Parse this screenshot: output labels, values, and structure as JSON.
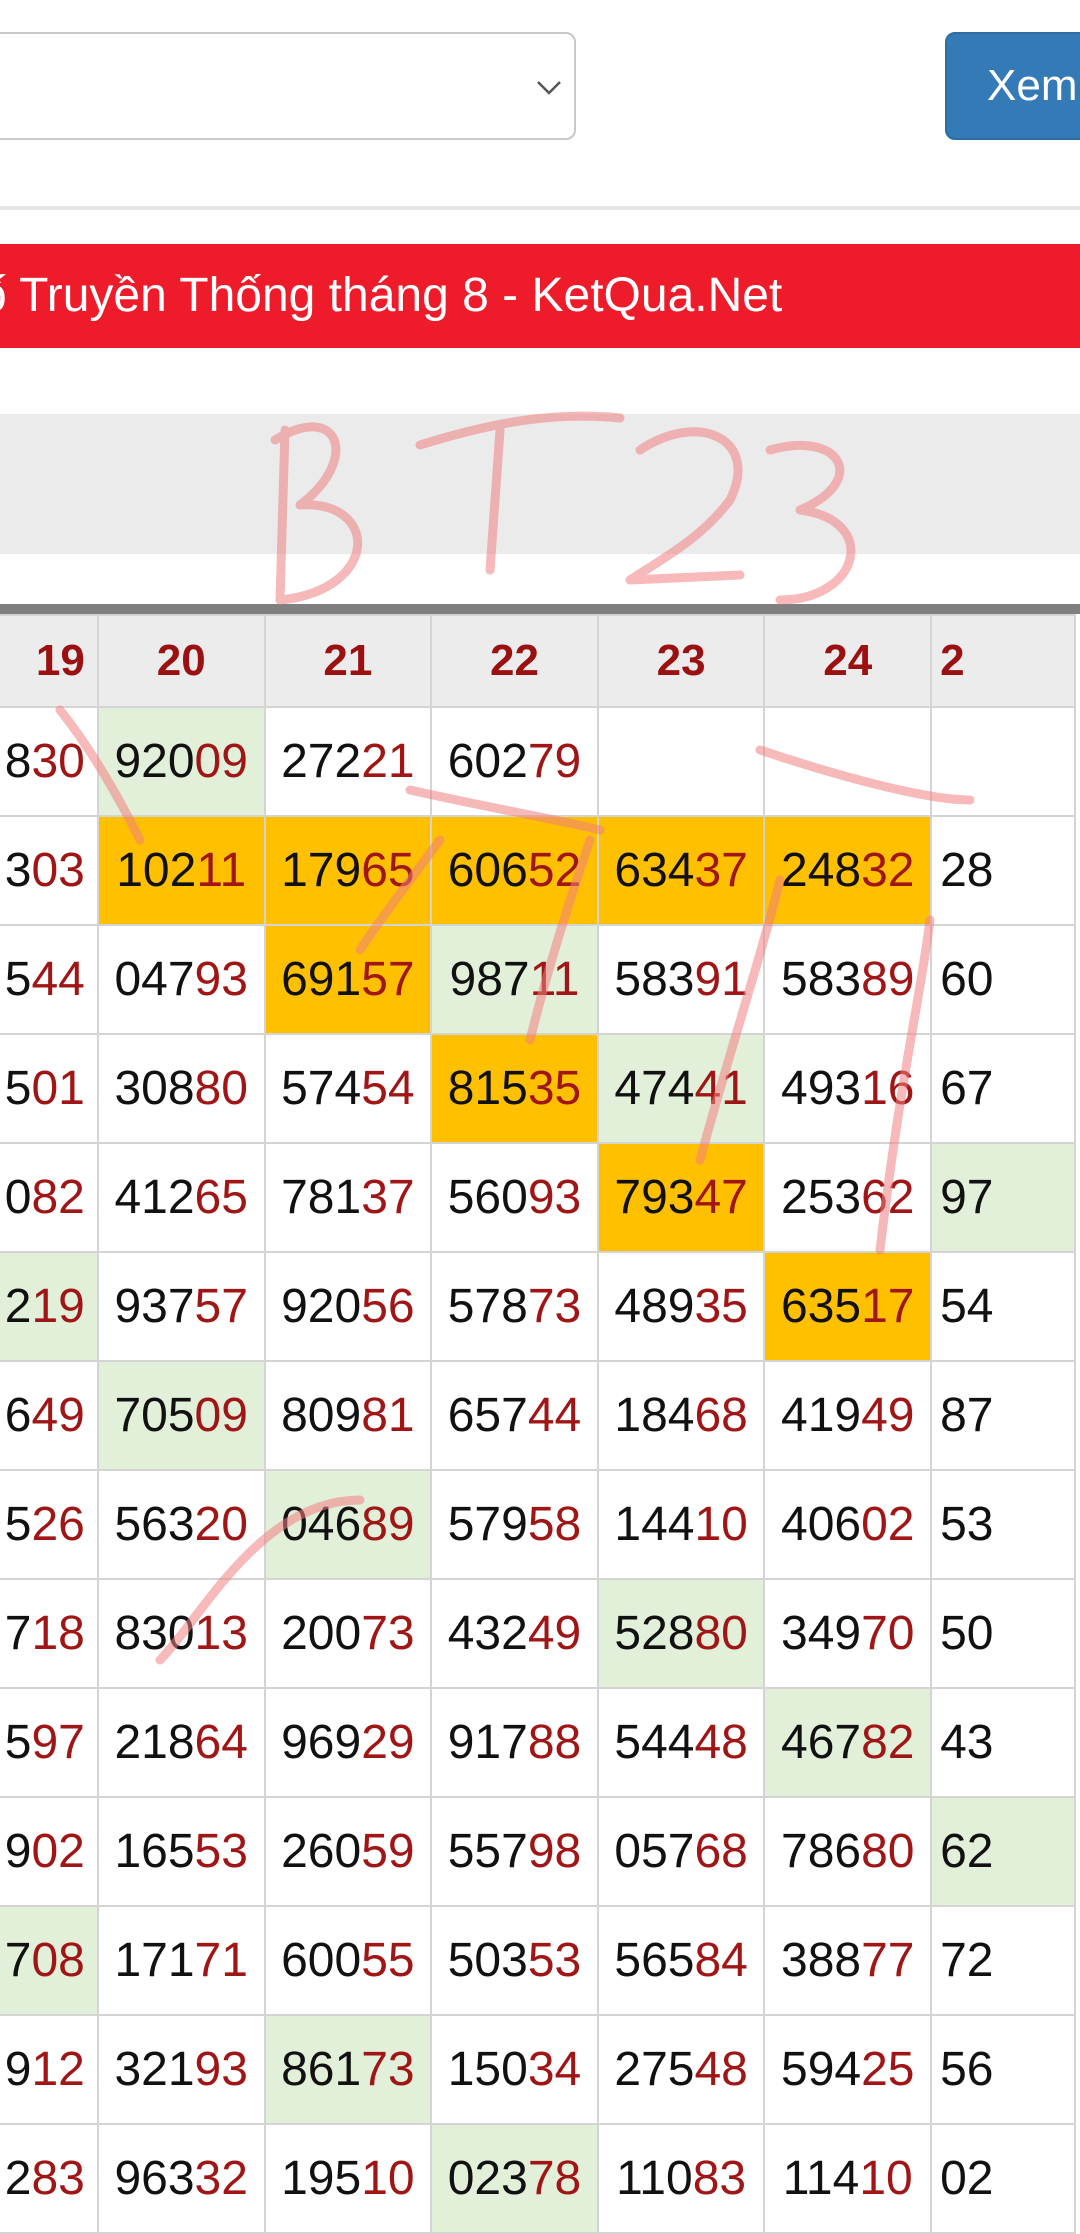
{
  "filter": {
    "select_value": ""
  },
  "xem_button": {
    "label": "Xem"
  },
  "title": {
    "text": "ố Truyền Thống tháng 8 - KetQua.Net"
  },
  "headers": [
    "19",
    "20",
    "21",
    "22",
    "23",
    "24",
    "2"
  ],
  "rows": [
    [
      {
        "h": "8",
        "t": "30"
      },
      {
        "h": "920",
        "t": "09",
        "s": "lg"
      },
      {
        "h": "272",
        "t": "21"
      },
      {
        "h": "602",
        "t": "79"
      },
      {
        "h": "",
        "t": ""
      },
      {
        "h": "",
        "t": ""
      },
      {
        "h": "",
        "t": ""
      }
    ],
    [
      {
        "h": "3",
        "t": "03"
      },
      {
        "h": "102",
        "t": "11",
        "s": "hl"
      },
      {
        "h": "179",
        "t": "65",
        "s": "hl"
      },
      {
        "h": "606",
        "t": "52",
        "s": "hl"
      },
      {
        "h": "634",
        "t": "37",
        "s": "hl"
      },
      {
        "h": "248",
        "t": "32",
        "s": "hl"
      },
      {
        "h": "28",
        "t": ""
      }
    ],
    [
      {
        "h": "5",
        "t": "44"
      },
      {
        "h": "047",
        "t": "93"
      },
      {
        "h": "691",
        "t": "57",
        "s": "hl"
      },
      {
        "h": "987",
        "t": "11",
        "s": "lg"
      },
      {
        "h": "583",
        "t": "91"
      },
      {
        "h": "583",
        "t": "89"
      },
      {
        "h": "60",
        "t": ""
      }
    ],
    [
      {
        "h": "5",
        "t": "01"
      },
      {
        "h": "308",
        "t": "80"
      },
      {
        "h": "574",
        "t": "54"
      },
      {
        "h": "815",
        "t": "35",
        "s": "hl"
      },
      {
        "h": "474",
        "t": "41",
        "s": "lg"
      },
      {
        "h": "493",
        "t": "16"
      },
      {
        "h": "67",
        "t": ""
      }
    ],
    [
      {
        "h": "0",
        "t": "82"
      },
      {
        "h": "412",
        "t": "65"
      },
      {
        "h": "781",
        "t": "37"
      },
      {
        "h": "560",
        "t": "93"
      },
      {
        "h": "793",
        "t": "47",
        "s": "hl"
      },
      {
        "h": "253",
        "t": "62"
      },
      {
        "h": "97",
        "t": "",
        "s": "lg"
      }
    ],
    [
      {
        "h": "2",
        "t": "19",
        "s": "lg"
      },
      {
        "h": "937",
        "t": "57"
      },
      {
        "h": "920",
        "t": "56"
      },
      {
        "h": "578",
        "t": "73"
      },
      {
        "h": "489",
        "t": "35"
      },
      {
        "h": "635",
        "t": "17",
        "s": "hl"
      },
      {
        "h": "54",
        "t": ""
      }
    ],
    [
      {
        "h": "6",
        "t": "49"
      },
      {
        "h": "705",
        "t": "09",
        "s": "lg"
      },
      {
        "h": "809",
        "t": "81"
      },
      {
        "h": "657",
        "t": "44"
      },
      {
        "h": "184",
        "t": "68"
      },
      {
        "h": "419",
        "t": "49"
      },
      {
        "h": "87",
        "t": ""
      }
    ],
    [
      {
        "h": "5",
        "t": "26"
      },
      {
        "h": "563",
        "t": "20"
      },
      {
        "h": "046",
        "t": "89",
        "s": "lg"
      },
      {
        "h": "579",
        "t": "58"
      },
      {
        "h": "144",
        "t": "10"
      },
      {
        "h": "406",
        "t": "02"
      },
      {
        "h": "53",
        "t": ""
      }
    ],
    [
      {
        "h": "7",
        "t": "18"
      },
      {
        "h": "830",
        "t": "13"
      },
      {
        "h": "200",
        "t": "73"
      },
      {
        "h": "432",
        "t": "49"
      },
      {
        "h": "528",
        "t": "80",
        "s": "lg"
      },
      {
        "h": "349",
        "t": "70"
      },
      {
        "h": "50",
        "t": ""
      }
    ],
    [
      {
        "h": "5",
        "t": "97"
      },
      {
        "h": "218",
        "t": "64"
      },
      {
        "h": "969",
        "t": "29"
      },
      {
        "h": "917",
        "t": "88"
      },
      {
        "h": "544",
        "t": "48"
      },
      {
        "h": "467",
        "t": "82",
        "s": "lg"
      },
      {
        "h": "43",
        "t": ""
      }
    ],
    [
      {
        "h": "9",
        "t": "02"
      },
      {
        "h": "165",
        "t": "53"
      },
      {
        "h": "260",
        "t": "59"
      },
      {
        "h": "557",
        "t": "98"
      },
      {
        "h": "057",
        "t": "68"
      },
      {
        "h": "786",
        "t": "80"
      },
      {
        "h": "62",
        "t": "",
        "s": "lg"
      }
    ],
    [
      {
        "h": "7",
        "t": "08",
        "s": "lg"
      },
      {
        "h": "171",
        "t": "71"
      },
      {
        "h": "600",
        "t": "55"
      },
      {
        "h": "503",
        "t": "53"
      },
      {
        "h": "565",
        "t": "84"
      },
      {
        "h": "388",
        "t": "77"
      },
      {
        "h": "72",
        "t": ""
      }
    ],
    [
      {
        "h": "9",
        "t": "12"
      },
      {
        "h": "321",
        "t": "93"
      },
      {
        "h": "861",
        "t": "73",
        "s": "lg"
      },
      {
        "h": "150",
        "t": "34"
      },
      {
        "h": "275",
        "t": "48"
      },
      {
        "h": "594",
        "t": "25"
      },
      {
        "h": "56",
        "t": ""
      }
    ],
    [
      {
        "h": "2",
        "t": "83"
      },
      {
        "h": "963",
        "t": "32"
      },
      {
        "h": "195",
        "t": "10"
      },
      {
        "h": "023",
        "t": "78",
        "s": "lg"
      },
      {
        "h": "110",
        "t": "83"
      },
      {
        "h": "114",
        "t": "10"
      },
      {
        "h": "02",
        "t": ""
      }
    ]
  ],
  "handwriting": {
    "text": "BT23",
    "color": "#f08080"
  }
}
